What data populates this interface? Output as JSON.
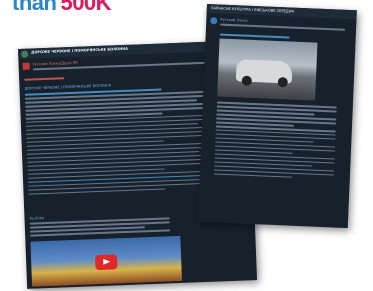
{
  "headline": {
    "prefix": "than",
    "value": "500K"
  },
  "left_window": {
    "title": "ДОРОЖЕ ЧЕРВОНЕ І ПОМОРЯНСЬКЕ БОЛОННА",
    "channel": "Русский Хокку(Друзі ПК",
    "post_heading": "ДОРОЖЕ ЧЕРВОНЕ І ПОМОРЯНСЬКЕ БОЛОННА",
    "video_caption": "YouTube"
  },
  "right_window": {
    "title": "ПАРНАСНЕ КУЛЬТУРА І ВІЙСЬКОВЕ СЕРЕДНЯ",
    "channel": "Русский Хокку"
  },
  "colors": {
    "headline_blue": "#2a85c9",
    "headline_pink": "#e0185c",
    "app_bg": "#17212b"
  }
}
